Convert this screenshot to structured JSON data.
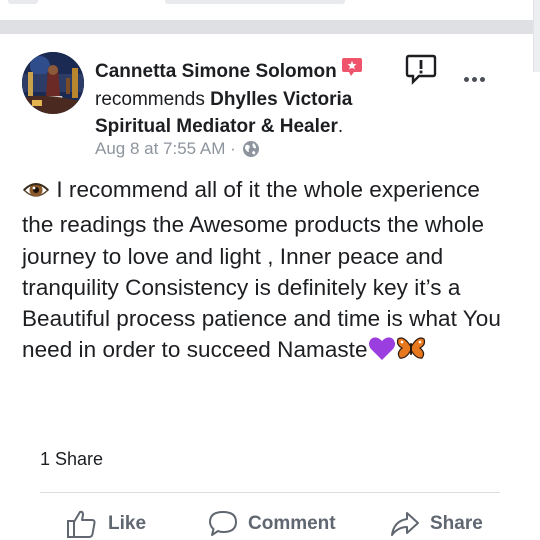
{
  "post": {
    "author": "Cannetta Simone Solomon",
    "action_text": "recommends",
    "target": "Dhylles Victoria Spiritual Mediator & Healer",
    "target_suffix": ".",
    "timestamp": "Aug 8 at 7:55 AM",
    "meta_separator": "·",
    "body": "I recommend all of it the whole experience the readings the Awesome products the whole journey to love and light , Inner peace and tranquility Consistency is definitely key it’s a Beautiful process patience and time is what You need in order to succeed Namaste",
    "body_emojis": [
      "eye-emoji",
      "purple-heart-emoji",
      "butterfly-emoji"
    ]
  },
  "engagement": {
    "shares": "1 Share"
  },
  "actions": {
    "like": "Like",
    "comment": "Comment",
    "share": "Share"
  },
  "icons": {
    "badge": "recommendation-badge-icon",
    "visibility": "globe-icon",
    "report": "report-icon",
    "more": "more-options-icon"
  },
  "colors": {
    "badge": "#f0546c",
    "meta_gray": "#8d949e",
    "action_gray": "#606770",
    "separator": "#dfe0e4"
  }
}
